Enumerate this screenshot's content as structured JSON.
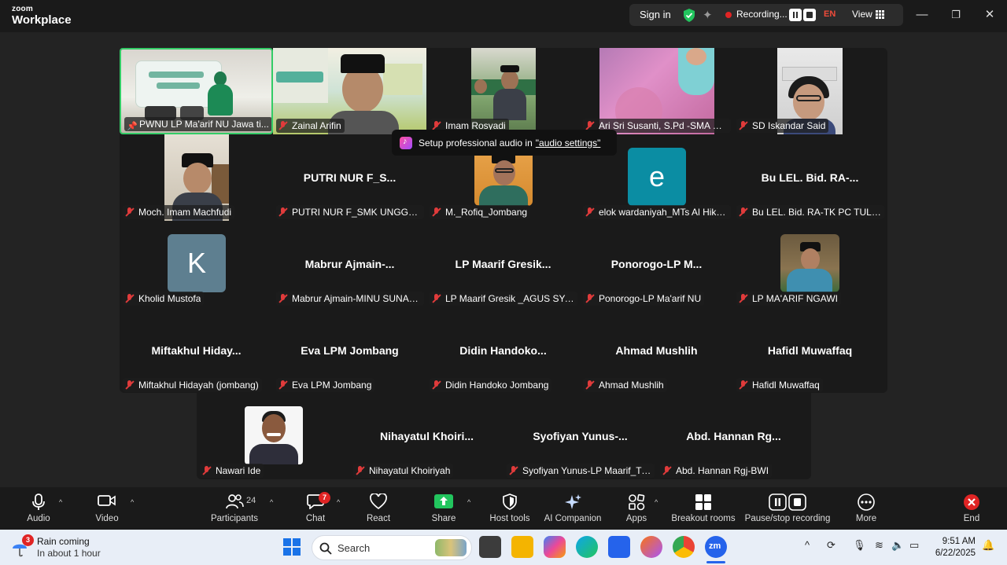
{
  "app": {
    "brand_line1": "zoom",
    "brand_line2": "Workplace"
  },
  "topbar": {
    "sign_in": "Sign in",
    "recording_status": "Recording...",
    "language": "EN",
    "view": "View"
  },
  "tooltip": {
    "text": "Setup professional audio in",
    "link": "\"audio settings\""
  },
  "participants": {
    "row1": [
      {
        "label": "PWNU LP Ma'arif NU Jawa ti...",
        "pinned": true,
        "active": true
      },
      {
        "label": "Zainal Arifin"
      },
      {
        "label": "Imam Rosyadi"
      },
      {
        "label": "Ari Sri Susanti, S.Pd -SMA W..."
      },
      {
        "label": "SD Iskandar Said"
      }
    ],
    "row2": [
      {
        "label": "Moch. Imam Machfudi"
      },
      {
        "label": "PUTRI NUR F_SMK UNGGULA...",
        "bigname": "PUTRI NUR F_S..."
      },
      {
        "label": "M._Rofiq_Jombang"
      },
      {
        "label": "elok wardaniyah_MTs Al Hika...",
        "avatar_letter": "e",
        "avatar_color": "#0b8da3"
      },
      {
        "label": "Bu LEL. Bid. RA-TK PC TULUN...",
        "bigname": "Bu LEL. Bid. RA-..."
      }
    ],
    "row3": [
      {
        "label": "Kholid Mustofa",
        "avatar_letter": "K",
        "avatar_color": "#5e7f90"
      },
      {
        "label": "Mabrur Ajmain-MINU SUNAN...",
        "bigname": "Mabrur  Ajmain-..."
      },
      {
        "label": "LP Maarif Gresik _AGUS SYAM...",
        "bigname": "LP  Maarif  Gresik..."
      },
      {
        "label": "Ponorogo-LP Ma'arif NU",
        "bigname": "Ponorogo-LP  M..."
      },
      {
        "label": "LP MA'ARIF NGAWI"
      }
    ],
    "row4": [
      {
        "label": "Miftakhul Hidayah (jombang)",
        "bigname": "Miftakhul  Hiday..."
      },
      {
        "label": "Eva LPM Jombang",
        "bigname": "Eva LPM Jombang"
      },
      {
        "label": "Didin Handoko Jombang",
        "bigname": "Didin  Handoko..."
      },
      {
        "label": "Ahmad Mushlih",
        "bigname": "Ahmad Mushlih"
      },
      {
        "label": "Hafidl Muwaffaq",
        "bigname": "Hafidl Muwaffaq"
      }
    ],
    "row5": [
      {
        "label": "Nawari Ide"
      },
      {
        "label": "Nihayatul Khoiriyah",
        "bigname": "Nihayatul  Khoiri..."
      },
      {
        "label": "Syofiyan Yunus-LP Maarif_Tub...",
        "bigname": "Syofiyan  Yunus-..."
      },
      {
        "label": "Abd. Hannan Rgj-BWI",
        "bigname": "Abd.  Hannan  Rg..."
      }
    ]
  },
  "toolbar": {
    "audio": "Audio",
    "video": "Video",
    "participants": "Participants",
    "participants_count": "24",
    "chat": "Chat",
    "chat_badge": "7",
    "react": "React",
    "share": "Share",
    "host_tools": "Host tools",
    "ai_companion": "AI Companion",
    "apps": "Apps",
    "breakout_rooms": "Breakout rooms",
    "pause_stop_recording": "Pause/stop recording",
    "more": "More",
    "end": "End"
  },
  "taskbar": {
    "weather_badge": "3",
    "weather_title": "Rain coming",
    "weather_sub": "In about 1 hour",
    "search": "Search",
    "time": "9:51 AM",
    "date": "6/22/2025"
  }
}
